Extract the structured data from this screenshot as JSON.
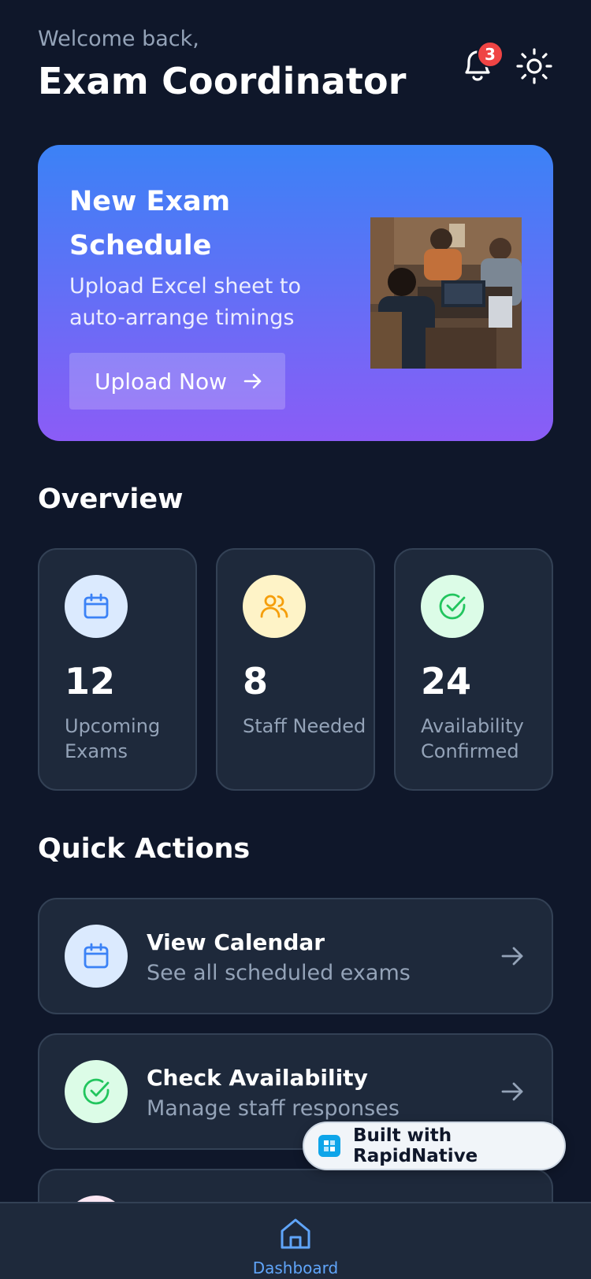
{
  "header": {
    "welcome": "Welcome back,",
    "title": "Exam Coordinator",
    "notification_count": "3",
    "icons": [
      "bell-icon",
      "sun-icon"
    ]
  },
  "hero": {
    "title": "New Exam Schedule",
    "subtitle": "Upload Excel sheet to auto-arrange timings",
    "button_label": "Upload Now",
    "image": "team-working-on-laptops-photo"
  },
  "overview": {
    "title": "Overview",
    "stats": [
      {
        "value": "12",
        "label": "Upcoming Exams",
        "icon": "calendar-icon",
        "icon_bg": "#dbeafe",
        "icon_color": "#3b82f6"
      },
      {
        "value": "8",
        "label": "Staff Needed",
        "icon": "users-icon",
        "icon_bg": "#fef3c7",
        "icon_color": "#f59e0b"
      },
      {
        "value": "24",
        "label": "Availability Confirmed",
        "icon": "check-circle-icon",
        "icon_bg": "#dcfce7",
        "icon_color": "#22c55e"
      }
    ]
  },
  "quick_actions": {
    "title": "Quick Actions",
    "items": [
      {
        "title": "View Calendar",
        "subtitle": "See all scheduled exams",
        "icon": "calendar-icon",
        "icon_bg": "#dbeafe"
      },
      {
        "title": "Check Availability",
        "subtitle": "Manage staff responses",
        "icon": "check-circle-icon",
        "icon_bg": "#dcfce7"
      }
    ]
  },
  "badge": {
    "label": "Built with RapidNative"
  },
  "nav": {
    "label": "Dashboard",
    "icon": "home-icon",
    "active_color": "#60a5fa"
  },
  "colors": {
    "background": "#0f172a",
    "card": "#1e293b",
    "hero_gradient_start": "#3b82f6",
    "hero_gradient_end": "#8b5cf6",
    "badge_red": "#ef4444"
  }
}
